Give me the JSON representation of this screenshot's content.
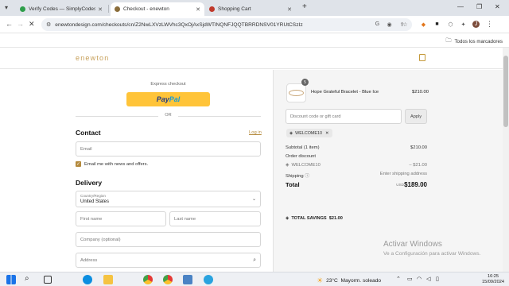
{
  "browser": {
    "tabs": [
      {
        "title": "Verify Codes — SimplyCodes",
        "active": false,
        "favicon_color": "#2e9e4a"
      },
      {
        "title": "Checkout - enewton",
        "active": true,
        "favicon_color": "#8a6d3b"
      },
      {
        "title": "Shopping Cart",
        "active": false,
        "favicon_color": "#c0392b"
      }
    ],
    "url": "enewtondesign.com/checkouts/cn/Z2NwLXVzLWVhc3QxOjAxSjdWTlNQNFJQQTBRRDNSV01YRUtCSzIz",
    "bookmarks_label": "Todos los marcadores",
    "profile_initial": "J"
  },
  "store": {
    "logo": "enewton"
  },
  "checkout": {
    "express_label": "Express checkout",
    "paypal_a": "Pay",
    "paypal_b": "Pal",
    "or_label": "OR",
    "contact_heading": "Contact",
    "login_link": "Log in",
    "email_placeholder": "Email",
    "newsletter_label": "Email me with news and offers.",
    "newsletter_checked": true,
    "delivery_heading": "Delivery",
    "country_label": "Country/Region",
    "country_value": "United States",
    "first_name_placeholder": "First name",
    "last_name_placeholder": "Last name",
    "company_placeholder": "Company (optional)",
    "address_placeholder": "Address"
  },
  "summary": {
    "product": {
      "name": "Hope Grateful Bracelet - Blue Ice",
      "price": "$210.00",
      "quantity": "5"
    },
    "discount_placeholder": "Discount code or gift card",
    "apply_label": "Apply",
    "applied_code": "WELCOME10",
    "subtotal_label": "Subtotal (1 item)",
    "subtotal_value": "$210.00",
    "order_discount_label": "Order discount",
    "discount_code": "WELCOME10",
    "discount_value": "– $21.00",
    "shipping_label": "Shipping",
    "shipping_value": "Enter shipping address",
    "total_label": "Total",
    "total_currency": "USD",
    "total_value": "$189.00",
    "savings_label": "TOTAL SAVINGS",
    "savings_value": "$21.00"
  },
  "watermark": {
    "title": "Activar Windows",
    "subtitle": "Ve a Configuración para activar Windows."
  },
  "taskbar": {
    "weather_temp": "23°C",
    "weather_text": "Mayorm. soleado",
    "time": "16:25",
    "date": "15/09/2024"
  }
}
